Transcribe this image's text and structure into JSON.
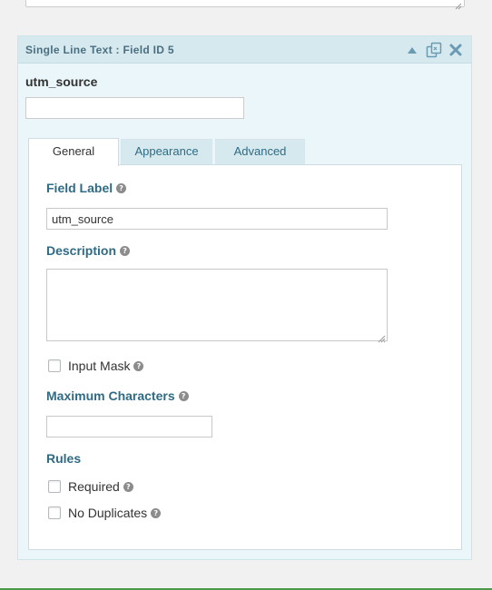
{
  "field": {
    "title": "Single Line Text : Field ID 5",
    "preview_label": "utm_source",
    "preview_value": ""
  },
  "tabs": [
    {
      "label": "General",
      "active": true
    },
    {
      "label": "Appearance",
      "active": false
    },
    {
      "label": "Advanced",
      "active": false
    }
  ],
  "general": {
    "field_label": {
      "label": "Field Label",
      "value": "utm_source"
    },
    "description": {
      "label": "Description",
      "value": ""
    },
    "input_mask": {
      "label": "Input Mask",
      "checked": false
    },
    "max_chars": {
      "label": "Maximum Characters",
      "value": ""
    },
    "rules": {
      "heading": "Rules",
      "required": {
        "label": "Required",
        "checked": false
      },
      "no_duplicates": {
        "label": "No Duplicates",
        "checked": false
      }
    }
  },
  "icons": {
    "collapse": "triangle-up-icon",
    "duplicate": "duplicate-icon",
    "delete": "close-icon",
    "help": "question-mark-icon"
  },
  "colors": {
    "card_bg": "#eaf6f9",
    "header_bg": "#d5e9ef",
    "label_blue": "#2f6b84",
    "icon_blue": "#5b8fa8"
  }
}
